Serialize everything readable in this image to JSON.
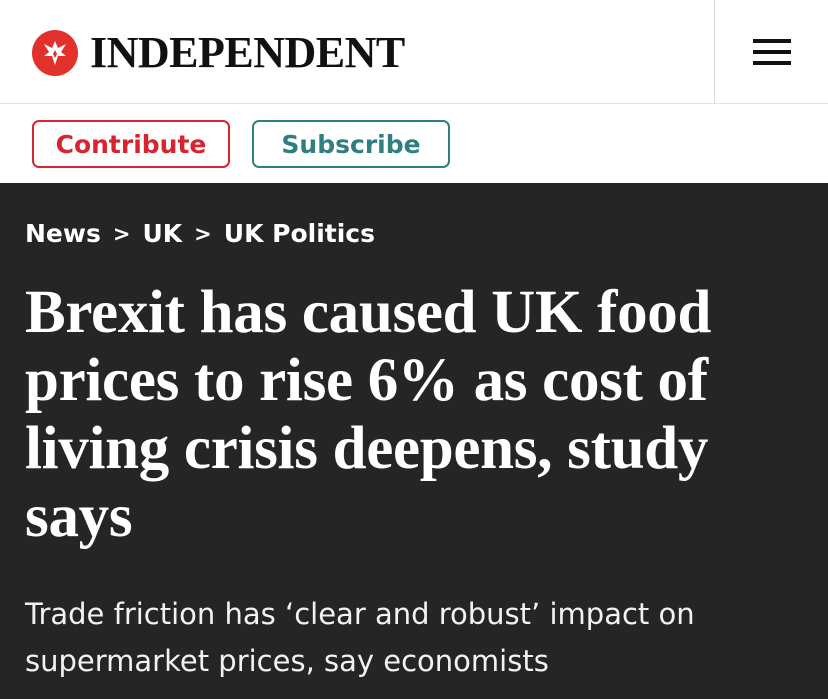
{
  "masthead": {
    "brand_name": "INDEPENDENT",
    "logo_icon": "eagle-icon",
    "menu_icon": "hamburger-menu-icon",
    "logo_color": "#e2312d"
  },
  "actions": {
    "contribute_label": "Contribute",
    "subscribe_label": "Subscribe",
    "contribute_color": "#d7242e",
    "subscribe_color": "#2f7f80"
  },
  "breadcrumb": {
    "items": [
      "News",
      "UK",
      "UK Politics"
    ],
    "separator": ">"
  },
  "article": {
    "headline": "Brexit has caused UK food prices to rise 6% as cost of living crisis deepens, study says",
    "standfirst": "Trade friction has ‘clear and robust’ impact on supermarket prices, say economists"
  }
}
